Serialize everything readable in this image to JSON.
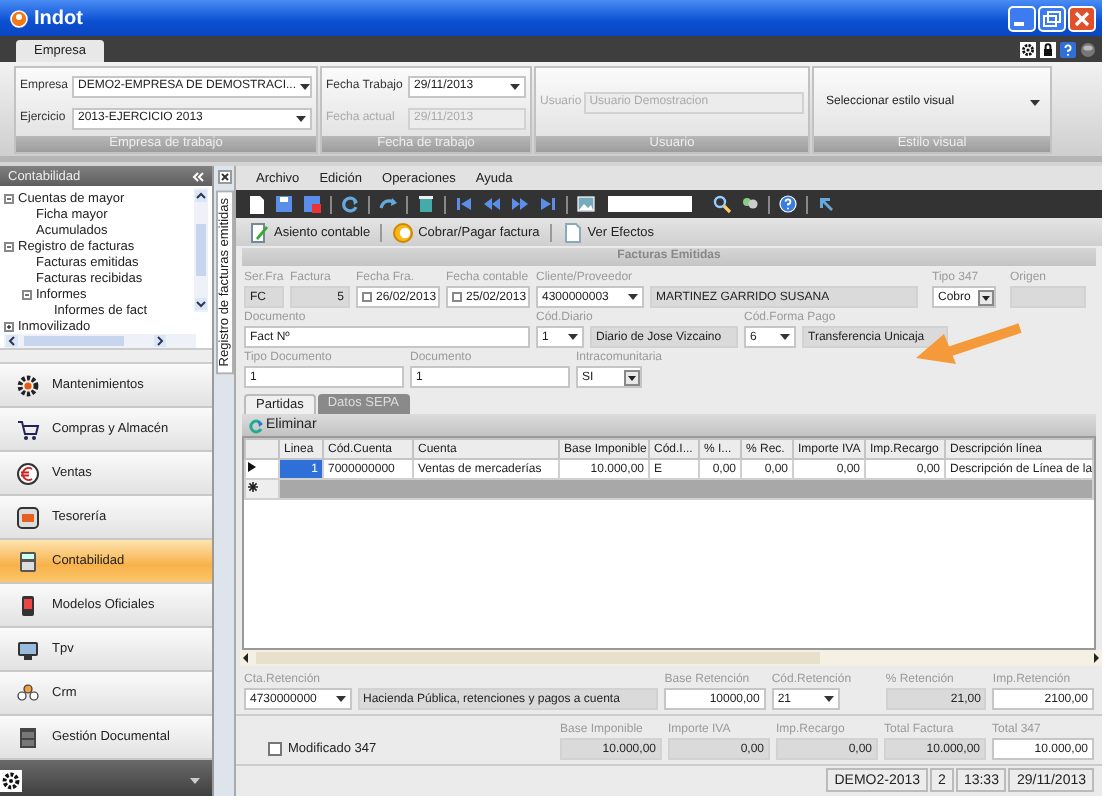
{
  "window": {
    "title": "Indot"
  },
  "ribbon": {
    "tabs": [
      {
        "label": "Empresa",
        "selected": true
      }
    ],
    "groups": [
      {
        "caption": "Empresa de trabajo",
        "fields": [
          {
            "label": "Empresa",
            "value": "DEMO2-EMPRESA DE DEMOSTRACI...",
            "kind": "combo",
            "disabled": false
          },
          {
            "label": "Ejercicio",
            "value": "2013-EJERCICIO 2013",
            "kind": "combo",
            "disabled": false
          }
        ]
      },
      {
        "caption": "Fecha de trabajo",
        "fields": [
          {
            "label": "Fecha Trabajo",
            "value": "29/11/2013",
            "kind": "combo",
            "disabled": false
          },
          {
            "label": "Fecha actual",
            "value": "29/11/2013",
            "kind": "text",
            "disabled": true
          }
        ]
      },
      {
        "caption": "Usuario",
        "fields": [
          {
            "label": "Usuario",
            "value": "Usuario Demostracion",
            "kind": "text",
            "disabled": true
          }
        ]
      },
      {
        "caption": "Estilo visual",
        "fields": [
          {
            "value": "Seleccionar estilo visual",
            "kind": "combo",
            "disabled": false
          }
        ]
      }
    ]
  },
  "sidebar": {
    "title": "Contabilidad",
    "tree": [
      {
        "label": "Cuentas de mayor",
        "expanded": true,
        "children": [
          {
            "label": "Ficha mayor"
          },
          {
            "label": "Acumulados"
          }
        ]
      },
      {
        "label": "Registro de facturas",
        "expanded": true,
        "children": [
          {
            "label": "Facturas emitidas"
          },
          {
            "label": "Facturas recibidas"
          },
          {
            "label": "Informes",
            "expanded": true,
            "children": [
              {
                "label": "Informes de fact"
              }
            ]
          }
        ]
      },
      {
        "label": "Inmovilizado",
        "expanded": false
      }
    ],
    "items": [
      {
        "label": "Mantenimientos",
        "selected": false
      },
      {
        "label": "Compras y Almacén",
        "selected": false
      },
      {
        "label": "Ventas",
        "selected": false
      },
      {
        "label": "Tesorería",
        "selected": false
      },
      {
        "label": "Contabilidad",
        "selected": true
      },
      {
        "label": "Modelos Oficiales",
        "selected": false
      },
      {
        "label": "Tpv",
        "selected": false
      },
      {
        "label": "Crm",
        "selected": false
      },
      {
        "label": "Gestión Documental",
        "selected": false
      }
    ]
  },
  "side_tab": {
    "label": "Registro de facturas emitidas"
  },
  "menu": [
    "Archivo",
    "Edición",
    "Operaciones",
    "Ayuda"
  ],
  "actions": [
    "Asiento contable",
    "Cobrar/Pagar factura",
    "Ver Efectos"
  ],
  "form": {
    "title": "Facturas Emitidas",
    "fields": [
      {
        "label": "Ser.Fra",
        "value": "FC",
        "kind": "text",
        "disabled": true
      },
      {
        "label": "Factura",
        "value": "5",
        "kind": "number",
        "disabled": true
      },
      {
        "label": "Fecha Fra.",
        "value": "26/02/2013",
        "kind": "date",
        "disabled": false
      },
      {
        "label": "Fecha contable",
        "value": "25/02/2013",
        "kind": "date",
        "disabled": false
      },
      {
        "label": "Cliente/Proveedor",
        "value": "4300000003",
        "kind": "combo",
        "disabled": false
      },
      {
        "value": "MARTINEZ GARRIDO SUSANA",
        "kind": "text",
        "disabled": true
      },
      {
        "label": "Tipo 347",
        "value": "Cobro",
        "kind": "select",
        "disabled": false
      },
      {
        "label": "Origen",
        "kind": "text",
        "disabled": true
      },
      {
        "label": "Documento",
        "value": "Fact Nº",
        "kind": "text",
        "disabled": false
      },
      {
        "label": "Cód.Diario",
        "value": "1",
        "kind": "combo",
        "disabled": false
      },
      {
        "value": "Diario de Jose Vizcaino",
        "kind": "text",
        "disabled": true
      },
      {
        "label": "Cód.Forma Pago",
        "value": "6",
        "kind": "combo",
        "disabled": false
      },
      {
        "value": "Transferencia Unicaja",
        "kind": "text",
        "disabled": true
      },
      {
        "label": "Tipo Documento",
        "value": "1",
        "kind": "text",
        "disabled": false
      },
      {
        "label": "Documento",
        "value": "1",
        "kind": "text",
        "disabled": false
      },
      {
        "label": "Intracomunitaria",
        "value": "SI",
        "kind": "select",
        "disabled": false
      }
    ]
  },
  "tabs": [
    {
      "label": "Partidas",
      "selected": true
    },
    {
      "label": "Datos SEPA",
      "selected": false
    }
  ],
  "grid_actions": [
    "Eliminar"
  ],
  "grid": {
    "columns": [
      "Linea",
      "Cód.Cuenta",
      "Cuenta",
      "Base Imponible",
      "Cód.I...",
      "% I...",
      "% Rec.",
      "Importe IVA",
      "Imp.Recargo",
      "Descripción línea"
    ],
    "rows": [
      {
        "selected": true,
        "cells": [
          "1",
          "7000000000",
          "Ventas de mercaderías",
          "10.000,00",
          "E",
          "0,00",
          "0,00",
          "0,00",
          "0,00",
          "Descripción de Línea de la"
        ]
      }
    ]
  },
  "retention": [
    {
      "label": "Cta.Retención",
      "value": "4730000000",
      "kind": "combo",
      "disabled": false
    },
    {
      "value": "Hacienda Pública, retenciones y pagos a cuenta",
      "kind": "text",
      "disabled": true
    },
    {
      "label": "Base Retención",
      "value": "10000,00",
      "kind": "number",
      "disabled": false
    },
    {
      "label": "Cód.Retención",
      "value": "21",
      "kind": "combo",
      "disabled": false
    },
    {
      "label": "% Retención",
      "value": "21,00",
      "kind": "number",
      "disabled": true
    },
    {
      "label": "Imp.Retención",
      "value": "2100,00",
      "kind": "number",
      "disabled": false
    }
  ],
  "totals": {
    "checkbox": {
      "label": "Modificado 347",
      "checked": false
    },
    "fields": [
      {
        "label": "Base Imponible",
        "value": "10.000,00",
        "kind": "number",
        "disabled": true
      },
      {
        "label": "Importe IVA",
        "value": "0,00",
        "kind": "number",
        "disabled": true
      },
      {
        "label": "Imp.Recargo",
        "value": "0,00",
        "kind": "number",
        "disabled": true
      },
      {
        "label": "Total Factura",
        "value": "10.000,00",
        "kind": "number",
        "disabled": true
      },
      {
        "label": "Total 347",
        "value": "10.000,00",
        "kind": "number",
        "disabled": false
      }
    ]
  },
  "status_bar": [
    "DEMO2-2013",
    "2",
    "13:33",
    "29/11/2013"
  ]
}
